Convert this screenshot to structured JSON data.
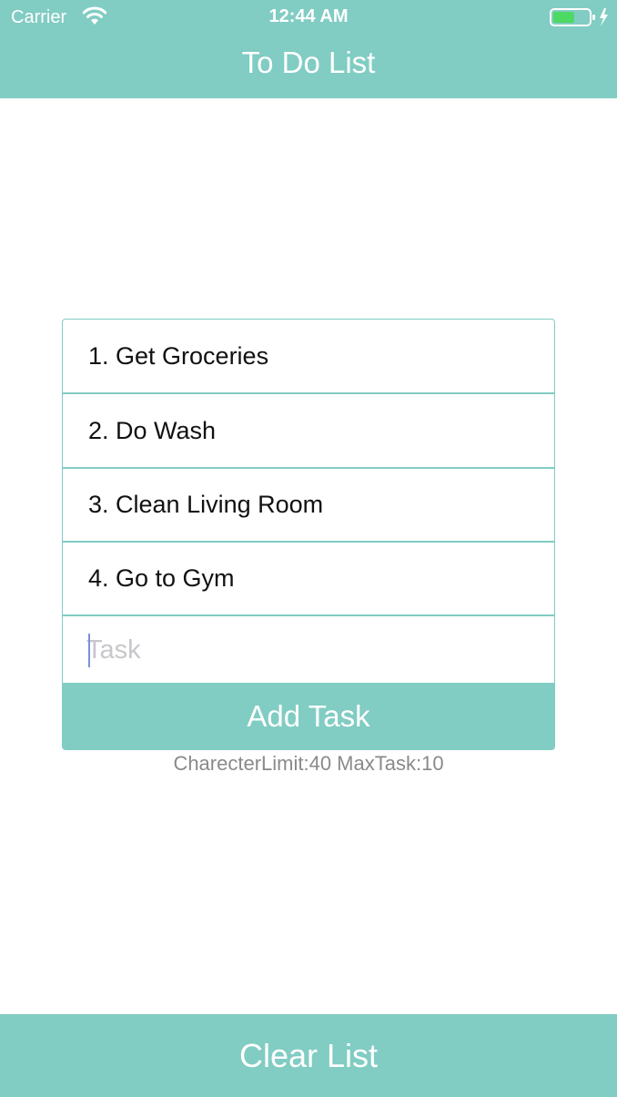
{
  "status_bar": {
    "carrier": "Carrier",
    "time": "12:44 AM",
    "wifi_icon": "wifi-icon",
    "battery_icon": "battery-charging-icon",
    "battery_level": 0.6
  },
  "header": {
    "title": "To Do List",
    "color": "#81ccc3"
  },
  "tasks": [
    {
      "label": "1. Get Groceries"
    },
    {
      "label": "2. Do Wash"
    },
    {
      "label": "3. Clean Living Room"
    },
    {
      "label": "4. Go to Gym"
    }
  ],
  "task_input": {
    "placeholder": "Task",
    "value": ""
  },
  "add_task": {
    "label": "Add Task"
  },
  "limits_text": "CharecterLimit:40 MaxTask:10",
  "clear_list": {
    "label": "Clear List"
  }
}
